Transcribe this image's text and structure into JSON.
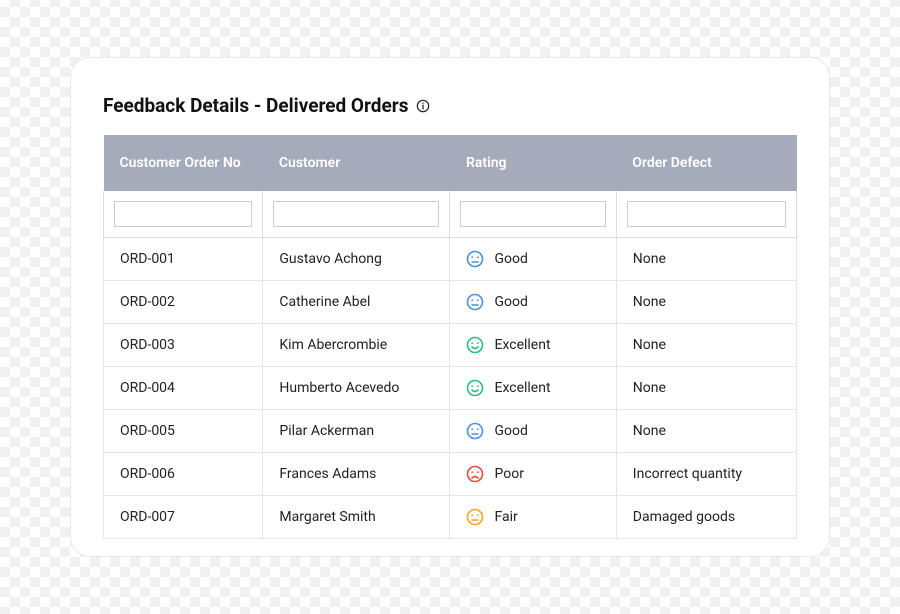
{
  "title": "Feedback Details - Delivered Orders",
  "columns": [
    "Customer Order No",
    "Customer",
    "Rating",
    "Order Defect"
  ],
  "rating_colors": {
    "Good": "#4a90e2",
    "Excellent": "#27c07d",
    "Poor": "#e74c3c",
    "Fair": "#f5a623"
  },
  "rows": [
    {
      "order_no": "ORD-001",
      "customer": "Gustavo Achong",
      "rating": "Good",
      "defect": "None"
    },
    {
      "order_no": "ORD-002",
      "customer": "Catherine Abel",
      "rating": "Good",
      "defect": "None"
    },
    {
      "order_no": "ORD-003",
      "customer": "Kim Abercrombie",
      "rating": "Excellent",
      "defect": "None"
    },
    {
      "order_no": "ORD-004",
      "customer": "Humberto Acevedo",
      "rating": "Excellent",
      "defect": "None"
    },
    {
      "order_no": "ORD-005",
      "customer": "Pilar Ackerman",
      "rating": "Good",
      "defect": "None"
    },
    {
      "order_no": "ORD-006",
      "customer": "Frances Adams",
      "rating": "Poor",
      "defect": "Incorrect quantity"
    },
    {
      "order_no": "ORD-007",
      "customer": "Margaret Smith",
      "rating": "Fair",
      "defect": "Damaged goods"
    }
  ]
}
